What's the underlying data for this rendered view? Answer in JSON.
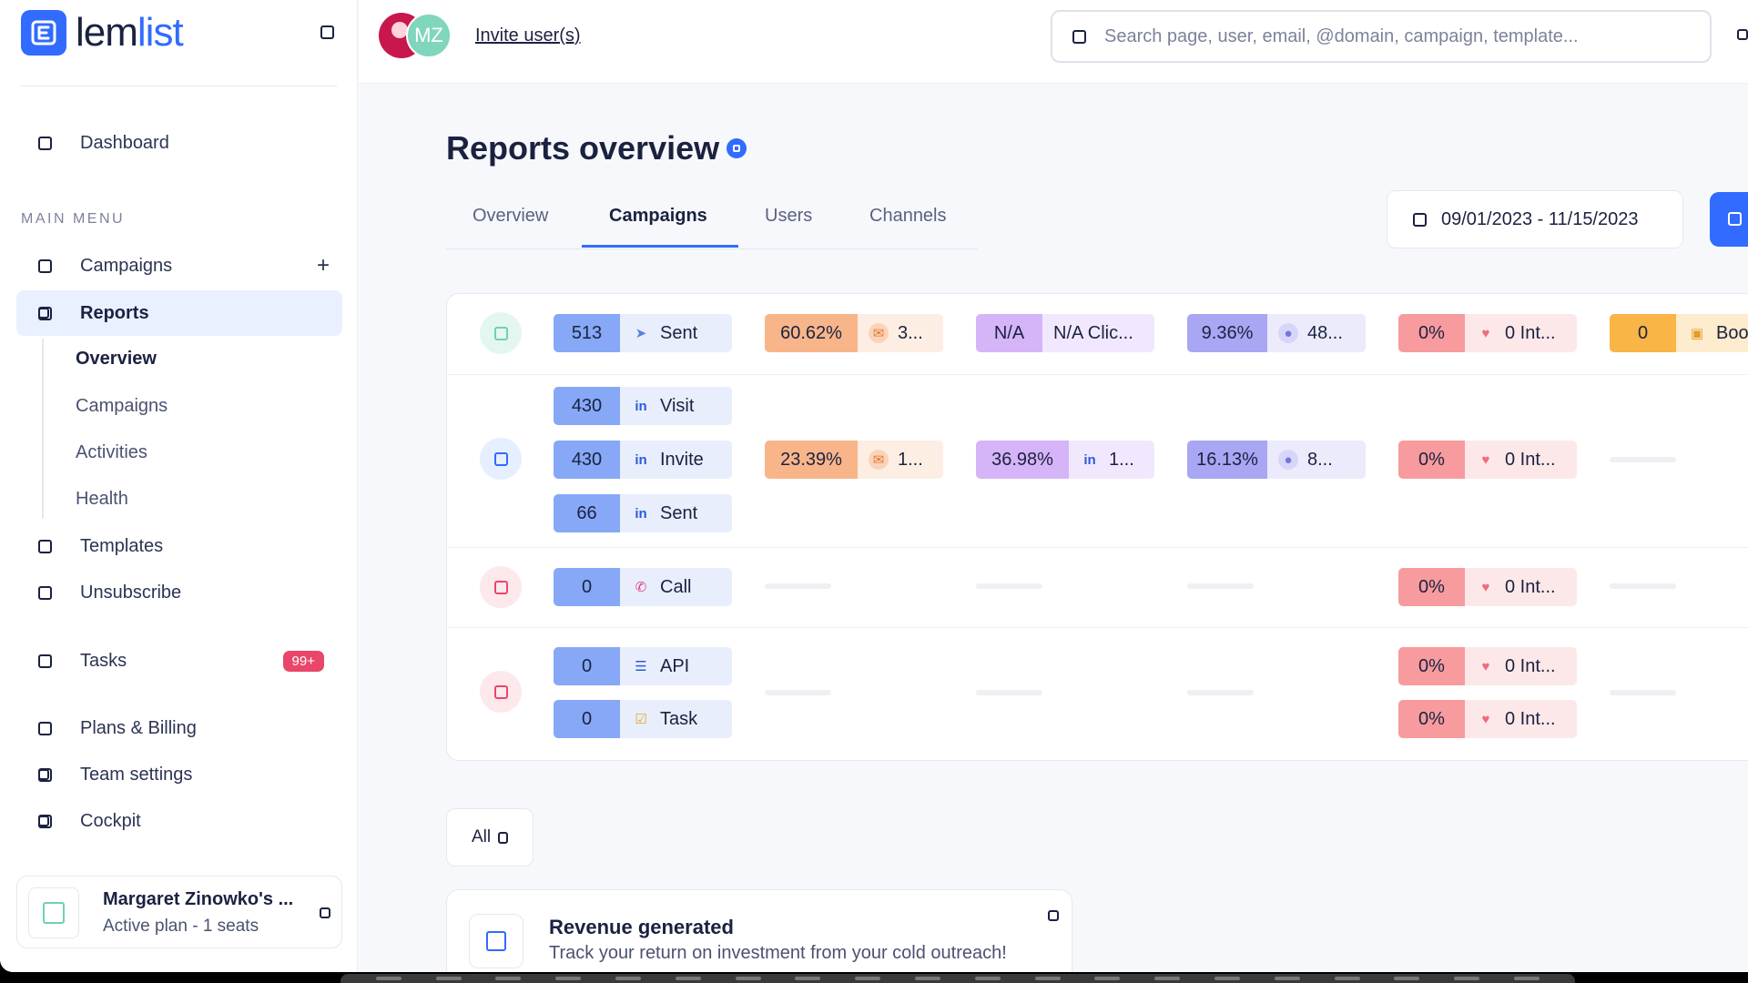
{
  "brand": {
    "name_part1": "lem",
    "name_part2": "list"
  },
  "sidebar": {
    "dashboard": "Dashboard",
    "menu_heading": "MAIN MENU",
    "items": {
      "campaigns": "Campaigns",
      "reports": "Reports",
      "templates": "Templates",
      "unsubscribe": "Unsubscribe",
      "tasks": "Tasks",
      "plans": "Plans & Billing",
      "team": "Team settings",
      "cockpit": "Cockpit"
    },
    "tasks_badge": "99+",
    "reports_sub": [
      "Overview",
      "Campaigns",
      "Activities",
      "Health"
    ],
    "account": {
      "name": "Margaret Zinowko's ...",
      "plan": "Active plan - 1 seats"
    }
  },
  "topbar": {
    "avatar_initials": "MZ",
    "invite": "Invite user(s)",
    "search_placeholder": "Search page, user, email, @domain, campaign, template..."
  },
  "main": {
    "title": "Reports overview",
    "tabs": [
      "Overview",
      "Campaigns",
      "Users",
      "Channels"
    ],
    "active_tab": "Campaigns",
    "date_range": "09/01/2023 - 11/15/2023"
  },
  "table": {
    "rows": {
      "email": {
        "sent": {
          "value": "513",
          "label": "Sent"
        },
        "opened": {
          "value": "60.62%",
          "label": "3..."
        },
        "clicked": {
          "value": "N/A",
          "label": "N/A Clic..."
        },
        "replied": {
          "value": "9.36%",
          "label": "48..."
        },
        "interested": {
          "value": "0%",
          "label": "0 Int..."
        },
        "booked": {
          "value": "0",
          "label": "Boo"
        }
      },
      "linkedin": {
        "visit": {
          "value": "430",
          "label": "Visit"
        },
        "invite": {
          "value": "430",
          "label": "Invite"
        },
        "sent": {
          "value": "66",
          "label": "Sent"
        },
        "opened": {
          "value": "23.39%",
          "label": "1..."
        },
        "accepted": {
          "value": "36.98%",
          "label": "1..."
        },
        "replied": {
          "value": "16.13%",
          "label": "8..."
        },
        "interested": {
          "value": "0%",
          "label": "0 Int..."
        }
      },
      "call": {
        "calls": {
          "value": "0",
          "label": "Call"
        },
        "interested": {
          "value": "0%",
          "label": "0 Int..."
        }
      },
      "other": {
        "api": {
          "value": "0",
          "label": "API"
        },
        "task": {
          "value": "0",
          "label": "Task"
        },
        "api_interested": {
          "value": "0%",
          "label": "0 Int..."
        },
        "task_interested": {
          "value": "0%",
          "label": "0 Int..."
        }
      }
    }
  },
  "filter": {
    "label": "All"
  },
  "revenue": {
    "title": "Revenue generated",
    "subtitle": "Track your return on investment from your cold outreach!"
  },
  "colors": {
    "accent": "#316bff",
    "metric_blue": "#86a8f6",
    "metric_orange": "#f8b58a",
    "metric_purple": "#d5b4f8",
    "metric_violet": "#a9a6f4",
    "metric_red": "#f79b9e",
    "metric_amber": "#f9b545",
    "badge": "#e9476a"
  }
}
